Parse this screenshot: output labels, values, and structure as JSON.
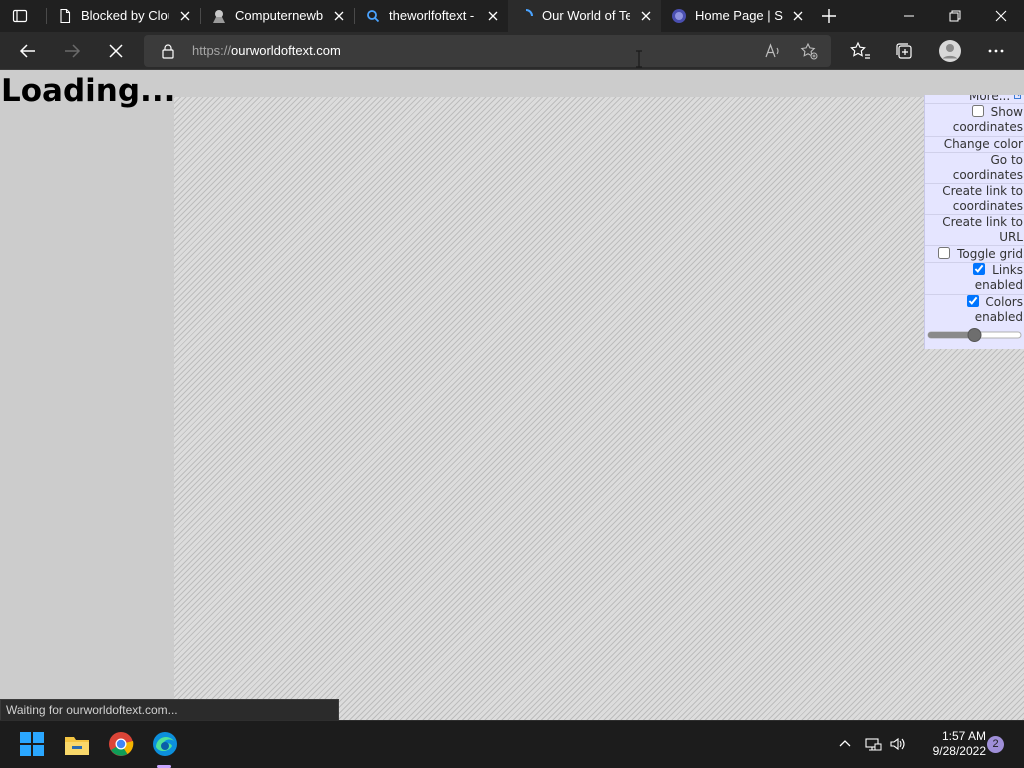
{
  "browser": {
    "tabs": [
      {
        "title": "Blocked by Clou",
        "icon": "page-icon",
        "active": false
      },
      {
        "title": "Computernewb",
        "icon": "logo-icon",
        "active": false
      },
      {
        "title": "theworlfoftext -",
        "icon": "search-icon",
        "active": false
      },
      {
        "title": "Our World of Te",
        "icon": "loading-icon",
        "active": true
      },
      {
        "title": "Home Page | Se",
        "icon": "site-logo-icon",
        "active": false
      }
    ],
    "address": {
      "scheme": "https://",
      "host": "ourworldoftext.com"
    },
    "status_text": "Waiting for ourworldoftext.com..."
  },
  "page": {
    "loading_text": "Loading...",
    "menu": {
      "more_label": "More...",
      "show_coordinates": {
        "label": "Show coordinates",
        "checked": false
      },
      "change_color": "Change color",
      "go_to_coordinates": "Go to coordinates",
      "create_link_coordinates": "Create link to coordinates",
      "create_link_url": "Create link to URL",
      "toggle_grid": {
        "label": "Toggle grid",
        "checked": false
      },
      "links_enabled": {
        "label": "Links enabled",
        "checked": true
      },
      "colors_enabled": {
        "label": "Colors enabled",
        "checked": true
      },
      "zoom_slider_value": 0.5
    }
  },
  "taskbar": {
    "time": "1:57 AM",
    "date": "9/28/2022",
    "notification_count": "2"
  },
  "colors": {
    "accent_edge": "#1e90ff",
    "menu_bg": "#e5e5ff",
    "page_bg": "#cccccc"
  }
}
